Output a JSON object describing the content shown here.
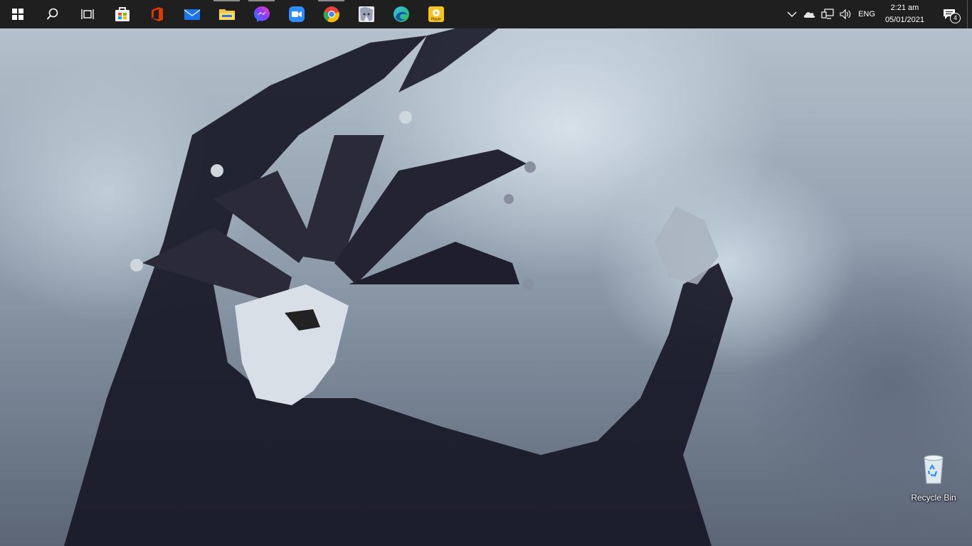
{
  "taskbar": {
    "apps": [
      {
        "name": "start-button",
        "icon": "windows-logo-icon"
      },
      {
        "name": "search-button",
        "icon": "search-icon"
      },
      {
        "name": "task-view-button",
        "icon": "task-view-icon"
      },
      {
        "name": "microsoft-store",
        "icon": "store-icon",
        "color": "#f3f3f3"
      },
      {
        "name": "microsoft-office",
        "icon": "office-icon",
        "color": "#d83b01"
      },
      {
        "name": "mail",
        "icon": "mail-icon",
        "color": "#1a73e8"
      },
      {
        "name": "file-explorer",
        "icon": "folder-icon",
        "color": "#f4c542",
        "running": true
      },
      {
        "name": "messenger",
        "icon": "messenger-icon",
        "color": "#7b61ff",
        "running": true
      },
      {
        "name": "zoom",
        "icon": "zoom-icon",
        "color": "#2d8cff"
      },
      {
        "name": "chrome",
        "icon": "chrome-icon",
        "color": "#34a853",
        "running": true
      },
      {
        "name": "anime-app",
        "icon": "anime-icon",
        "color": "#d9d9e6"
      },
      {
        "name": "edge",
        "icon": "edge-icon",
        "color": "#1fa0e3"
      },
      {
        "name": "player",
        "icon": "player-icon",
        "color": "#f7c31c",
        "label": "Player"
      }
    ],
    "tray": {
      "language": "ENG",
      "time": "2:21 am",
      "date": "05/01/2021",
      "notification_count": "4"
    }
  },
  "desktop": {
    "icons": [
      {
        "label": "Recycle Bin",
        "icon": "recycle-bin-icon"
      }
    ]
  }
}
